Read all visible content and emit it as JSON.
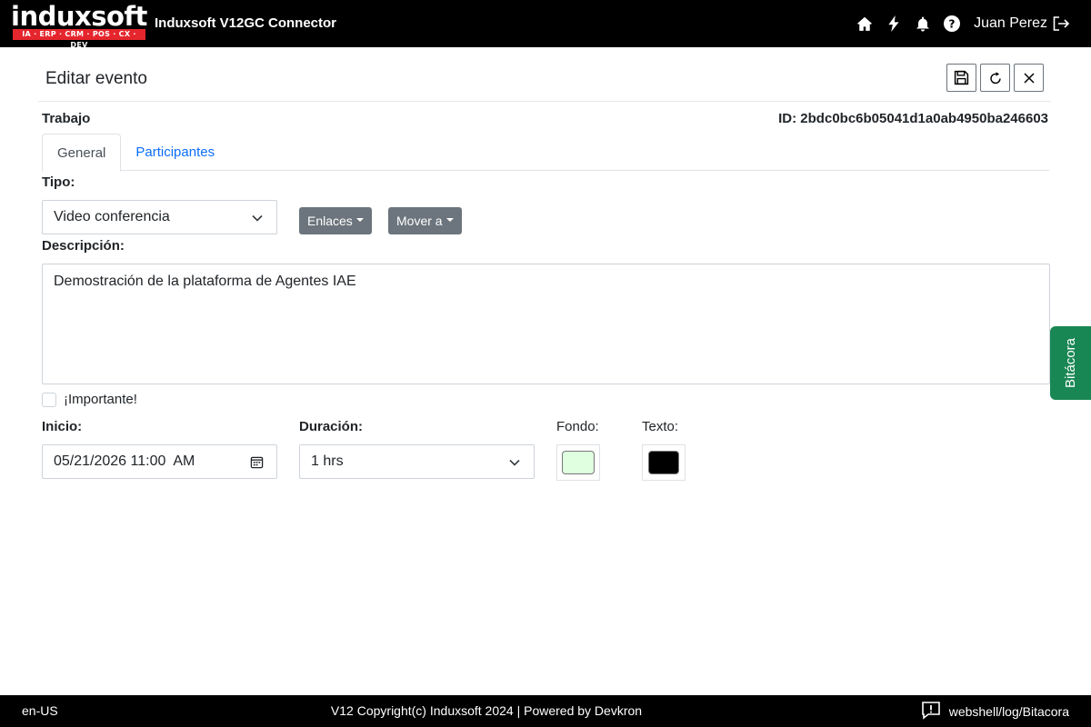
{
  "app": {
    "logo_text": "induxsoft",
    "logo_tagline": "IA · ERP · CRM · POS · CX · DEV",
    "title": "Induxsoft V12GC Connector",
    "user_name": "Juan Perez",
    "icons": [
      "home-icon",
      "bolt-icon",
      "bell-icon",
      "help-icon",
      "logout-icon"
    ]
  },
  "page": {
    "title": "Editar evento",
    "section": "Trabajo",
    "id_text": "ID: 2bdc0bc6b05041d1a0ab4950ba246603",
    "toolbar": [
      "save-icon",
      "refresh-icon",
      "close-icon"
    ]
  },
  "tabs": [
    {
      "label": "General",
      "active": true
    },
    {
      "label": "Participantes",
      "active": false
    }
  ],
  "form": {
    "tipo_label": "Tipo:",
    "tipo_value": "Video conferencia",
    "enlaces_label": "Enlaces",
    "mover_label": "Mover a",
    "descripcion_label": "Descripción:",
    "descripcion_value": "Demostración de la plataforma de Agentes IAE",
    "importante_label": "¡Importante!",
    "importante_checked": false,
    "inicio_label": "Inicio:",
    "inicio_value": "05/21/2026 11:00  AM",
    "duracion_label": "Duración:",
    "duracion_value": "1 hrs",
    "fondo_label": "Fondo:",
    "fondo_color": "#dfffe0",
    "texto_label": "Texto:",
    "texto_color": "#000000"
  },
  "side_tab": {
    "label": "Bitácora",
    "color": "#198754"
  },
  "footer": {
    "locale": "en-US",
    "copyright": "V12 Copyright(c) Induxsoft 2024 | Powered by Devkron",
    "log_path": "webshell/log/Bitacora"
  }
}
